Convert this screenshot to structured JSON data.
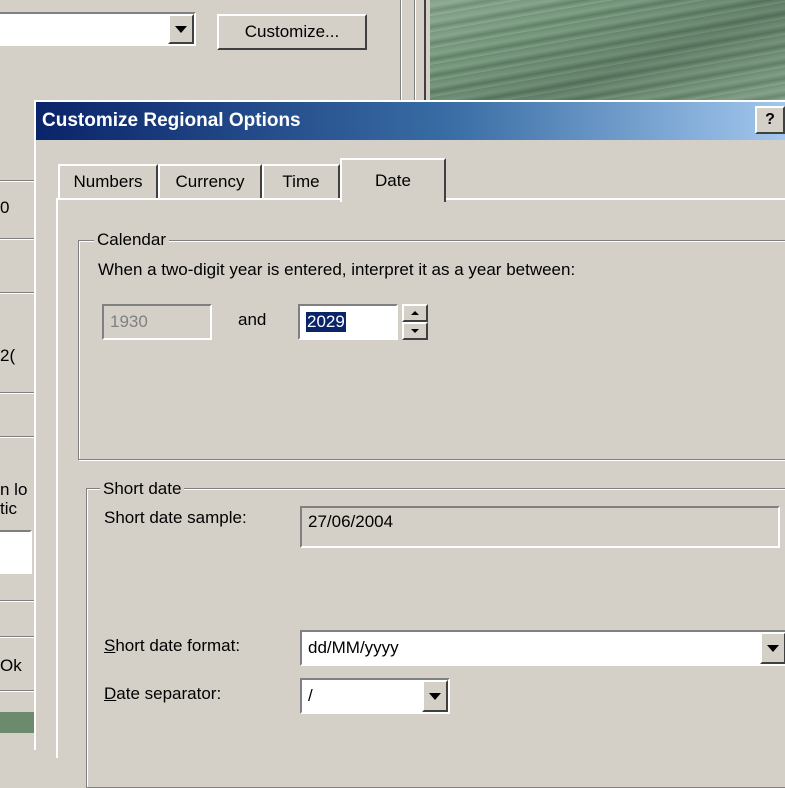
{
  "background": {
    "customize_button": "Customize...",
    "cell_texts": [
      "0",
      "2(",
      "n lo",
      "tic",
      "Ok"
    ]
  },
  "dialog": {
    "title": "Customize Regional Options",
    "help_button": "?",
    "tabs": [
      "Numbers",
      "Currency",
      "Time",
      "Date"
    ],
    "selected_tab": "Date",
    "calendar": {
      "legend": "Calendar",
      "description": "When a two-digit year is entered, interpret it as a year between:",
      "year_from": "1930",
      "and_label": "and",
      "year_to": "2029"
    },
    "short_date": {
      "legend": "Short date",
      "sample_label": "Short date sample:",
      "sample_value": "27/06/2004",
      "format_label_prefix": "S",
      "format_label_rest": "hort date format:",
      "format_value": "dd/MM/yyyy",
      "separator_label_prefix": "D",
      "separator_label_rest": "ate separator:",
      "separator_value": "/"
    }
  },
  "colors": {
    "titlebar_start": "#0a246a",
    "titlebar_end": "#a6caf0",
    "face": "#d4d0c8",
    "selection": "#0a246a"
  }
}
